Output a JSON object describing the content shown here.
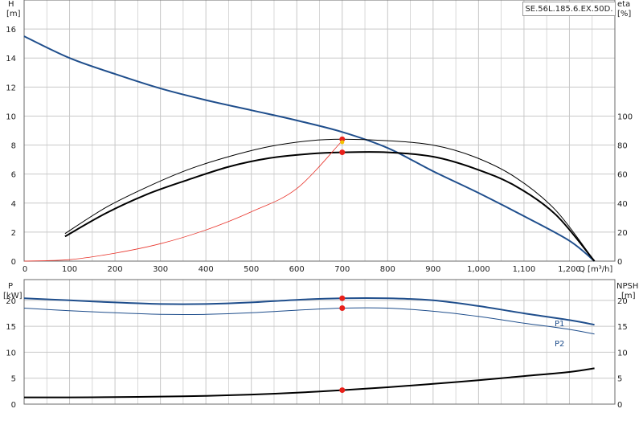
{
  "model": "SE.56L.185.6.EX.50D.",
  "colors": {
    "head": "#1f4e8c",
    "eta": "#000000",
    "pump_eta": "#000000",
    "system": "#e8332a",
    "p1": "#1f4e8c",
    "p2": "#1f4e8c",
    "npsh": "#000000",
    "duty_point": "#e8201a",
    "grid": "#c8c8c8"
  },
  "chart_data": [
    {
      "type": "line",
      "axes": {
        "x": {
          "label": "Q [m³/h]",
          "range": [
            0,
            1300
          ],
          "ticks": [
            "0",
            "100",
            "200",
            "300",
            "400",
            "500",
            "600",
            "700",
            "800",
            "900",
            "1,000",
            "1,100",
            "1,200"
          ]
        },
        "y_left": {
          "label_top": "H",
          "label_unit": "[m]",
          "range": [
            0,
            18
          ],
          "ticks": [
            "0",
            "2",
            "4",
            "6",
            "8",
            "10",
            "12",
            "14",
            "16"
          ]
        },
        "y_right": {
          "label_top": "eta",
          "label_unit": "[%]",
          "range": [
            0,
            180
          ],
          "ticks": [
            "0",
            "20",
            "40",
            "60",
            "80",
            "100"
          ]
        }
      },
      "grid": true,
      "series": [
        {
          "key": "head",
          "axis": "left",
          "x": [
            0,
            100,
            200,
            300,
            400,
            500,
            600,
            700,
            800,
            900,
            1000,
            1100,
            1200,
            1255
          ],
          "y": [
            15.5,
            14.0,
            12.9,
            11.9,
            11.1,
            10.4,
            9.7,
            8.9,
            7.8,
            6.2,
            4.7,
            3.1,
            1.4,
            0
          ]
        },
        {
          "key": "eta",
          "axis": "right",
          "x": [
            90,
            180,
            270,
            360,
            450,
            540,
            630,
            700,
            800,
            900,
            990,
            1080,
            1170,
            1255
          ],
          "y": [
            19,
            37,
            51,
            63,
            72,
            79,
            83,
            84,
            83,
            80,
            72,
            58,
            35,
            0
          ]
        },
        {
          "key": "pump_eta",
          "axis": "right",
          "x": [
            90,
            180,
            270,
            360,
            450,
            540,
            630,
            700,
            800,
            900,
            990,
            1080,
            1170,
            1255
          ],
          "y": [
            17,
            33,
            46,
            56,
            65,
            71,
            74,
            75,
            75,
            72,
            64,
            52,
            32,
            0
          ]
        },
        {
          "key": "system",
          "axis": "left",
          "x": [
            0,
            100,
            200,
            300,
            400,
            500,
            600,
            700
          ],
          "y": [
            0,
            0.1,
            0.55,
            1.2,
            2.15,
            3.4,
            5.0,
            8.3
          ]
        }
      ],
      "duty_points": [
        {
          "x": 700,
          "y": 8.4,
          "axis": "left"
        },
        {
          "x": 700,
          "y": 75,
          "axis": "right"
        }
      ]
    },
    {
      "type": "line",
      "axes": {
        "x": {
          "range": [
            0,
            1300
          ]
        },
        "y_left": {
          "label_top": "P",
          "label_unit": "[kW]",
          "range": [
            0,
            24
          ],
          "ticks": [
            "0",
            "5",
            "10",
            "15",
            "20"
          ]
        },
        "y_right": {
          "label_top": "NPSH",
          "label_unit": "[m]",
          "range": [
            0,
            24
          ],
          "ticks": [
            "0",
            "5",
            "10",
            "15",
            "20"
          ]
        }
      },
      "grid": true,
      "series": [
        {
          "key": "p1",
          "name": "P1",
          "axis": "left",
          "x": [
            0,
            100,
            200,
            300,
            400,
            500,
            600,
            700,
            800,
            900,
            1000,
            1100,
            1200,
            1255
          ],
          "y": [
            20.4,
            20.0,
            19.6,
            19.3,
            19.3,
            19.6,
            20.1,
            20.4,
            20.4,
            20.0,
            18.9,
            17.5,
            16.2,
            15.3
          ]
        },
        {
          "key": "p2",
          "name": "P2",
          "axis": "left",
          "x": [
            0,
            100,
            200,
            300,
            400,
            500,
            600,
            700,
            800,
            900,
            1000,
            1100,
            1200,
            1255
          ],
          "y": [
            18.5,
            18.0,
            17.6,
            17.3,
            17.3,
            17.6,
            18.1,
            18.5,
            18.5,
            17.9,
            16.9,
            15.6,
            14.4,
            13.5
          ]
        },
        {
          "key": "npsh",
          "axis": "right",
          "x": [
            0,
            100,
            200,
            300,
            400,
            500,
            600,
            700,
            800,
            900,
            1000,
            1100,
            1200,
            1255
          ],
          "y": [
            1.3,
            1.3,
            1.35,
            1.45,
            1.6,
            1.85,
            2.2,
            2.7,
            3.25,
            3.9,
            4.6,
            5.4,
            6.2,
            6.9
          ]
        }
      ],
      "duty_points": [
        {
          "x": 700,
          "y": 20.4,
          "axis": "left"
        },
        {
          "x": 700,
          "y": 18.5,
          "axis": "left"
        },
        {
          "x": 700,
          "y": 2.7,
          "axis": "right"
        }
      ]
    }
  ]
}
